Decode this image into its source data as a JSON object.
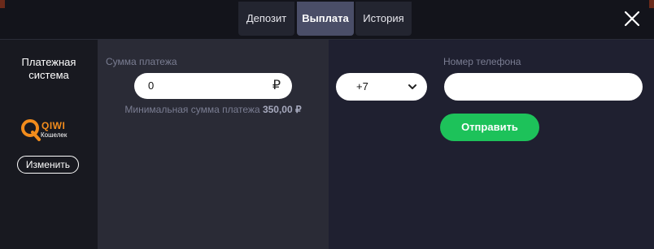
{
  "tabs": [
    {
      "label": "Депозит"
    },
    {
      "label": "Выплата"
    },
    {
      "label": "История"
    }
  ],
  "payment_system": {
    "title": "Платежная\nсистема",
    "brand": "QIWI",
    "brand_sub": "Кошелек",
    "change_label": "Изменить"
  },
  "amount": {
    "label": "Сумма платежа",
    "value": "0",
    "currency": "₽",
    "min_text": "Минимальная сумма платежа",
    "min_value": "350,00 ₽"
  },
  "phone": {
    "code": "+7",
    "label": "Номер телефона",
    "value": ""
  },
  "send_label": "Отправить",
  "colors": {
    "accent_green": "#1dc25a",
    "active_tab": "#4a4e68",
    "qiwi_orange": "#f28c1c"
  }
}
